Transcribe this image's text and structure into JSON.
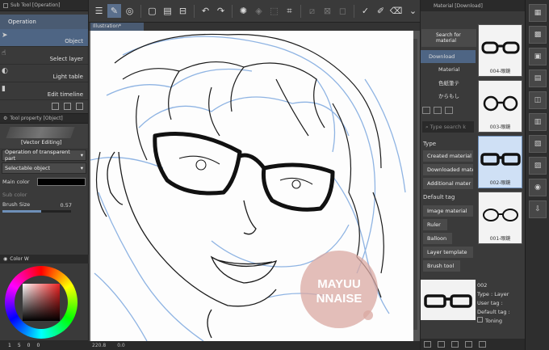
{
  "subtool": {
    "title": "Sub Tool [Operation]",
    "group": "Operation",
    "items": [
      {
        "label": "Object",
        "selected": true
      },
      {
        "label": "Select layer",
        "selected": false
      },
      {
        "label": "Light table",
        "selected": false
      },
      {
        "label": "Edit timeline",
        "selected": false
      }
    ]
  },
  "toolprop": {
    "title": "Tool property [Object]",
    "mode": "[Vector Editing]",
    "operation_value": "Operation of transparent part",
    "selectable_value": "Selectable object",
    "main_color_label": "Main color",
    "sub_color_label": "Sub color",
    "brush_size_label": "Brush Size",
    "brush_size_value": "0.57",
    "brush_size_fraction": 0.57
  },
  "color_panel": {
    "title": "Color W",
    "readout": [
      "1",
      "5",
      "0",
      "0"
    ]
  },
  "canvas": {
    "tab": "Illustration*",
    "zoom": "220.8",
    "angle": "0.0",
    "watermark_line1": "MAYUU",
    "watermark_line2": "NNAISE"
  },
  "material": {
    "title": "Material [Download]",
    "search_button": "Search for material",
    "tree": [
      "Download",
      "Material",
      "色紙筆テ",
      "からもし"
    ],
    "search_placeholder": "Type search k",
    "type_label": "Type",
    "type_buttons": [
      "Created material",
      "Downloaded mate",
      "Additional mater"
    ],
    "default_tag_label": "Default tag",
    "tag_buttons": [
      "Image material",
      "Ruler",
      "Balloon",
      "Layer template",
      "Brush tool"
    ],
    "tiles": [
      {
        "caption": "004-眼鏡",
        "selected": false
      },
      {
        "caption": "003-眼鏡",
        "selected": false
      },
      {
        "caption": "002-眼鏡",
        "selected": true
      },
      {
        "caption": "001-眼鏡",
        "selected": false
      }
    ],
    "info": {
      "name": "002",
      "type": "Type : Layer",
      "user_tag": "User tag :",
      "default_tag": "Default tag :",
      "toning": "Toning"
    }
  },
  "colors": {
    "accent": "#4e6584",
    "sketch_blue": "#8fb4e3",
    "watermark": "#d9a8a1"
  }
}
